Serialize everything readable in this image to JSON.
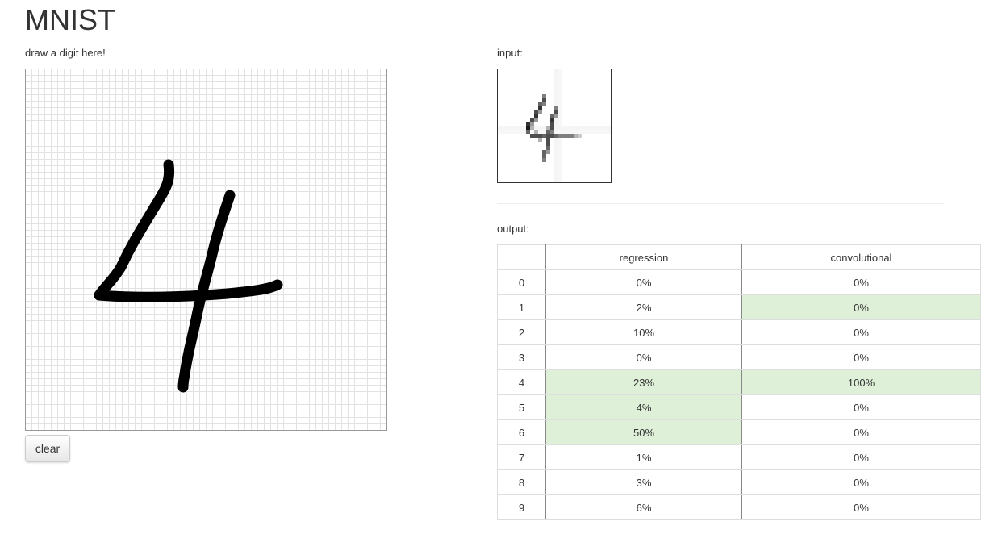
{
  "title": "MNIST",
  "draw": {
    "label": "draw a digit here!",
    "clear_label": "clear"
  },
  "input": {
    "label": "input:"
  },
  "output": {
    "label": "output:",
    "headers": [
      "",
      "regression",
      "convolutional"
    ],
    "highlight_color": "#dff0d8",
    "rows": [
      {
        "digit": "0",
        "regression": "0%",
        "convolutional": "0%",
        "reg_hl": false,
        "conv_hl": false
      },
      {
        "digit": "1",
        "regression": "2%",
        "convolutional": "0%",
        "reg_hl": false,
        "conv_hl": true
      },
      {
        "digit": "2",
        "regression": "10%",
        "convolutional": "0%",
        "reg_hl": false,
        "conv_hl": false
      },
      {
        "digit": "3",
        "regression": "0%",
        "convolutional": "0%",
        "reg_hl": false,
        "conv_hl": false
      },
      {
        "digit": "4",
        "regression": "23%",
        "convolutional": "100%",
        "reg_hl": true,
        "conv_hl": true
      },
      {
        "digit": "5",
        "regression": "4%",
        "convolutional": "0%",
        "reg_hl": true,
        "conv_hl": false
      },
      {
        "digit": "6",
        "regression": "50%",
        "convolutional": "0%",
        "reg_hl": true,
        "conv_hl": false
      },
      {
        "digit": "7",
        "regression": "1%",
        "convolutional": "0%",
        "reg_hl": false,
        "conv_hl": false
      },
      {
        "digit": "8",
        "regression": "3%",
        "convolutional": "0%",
        "reg_hl": false,
        "conv_hl": false
      },
      {
        "digit": "9",
        "regression": "6%",
        "convolutional": "0%",
        "reg_hl": false,
        "conv_hl": false
      }
    ]
  }
}
